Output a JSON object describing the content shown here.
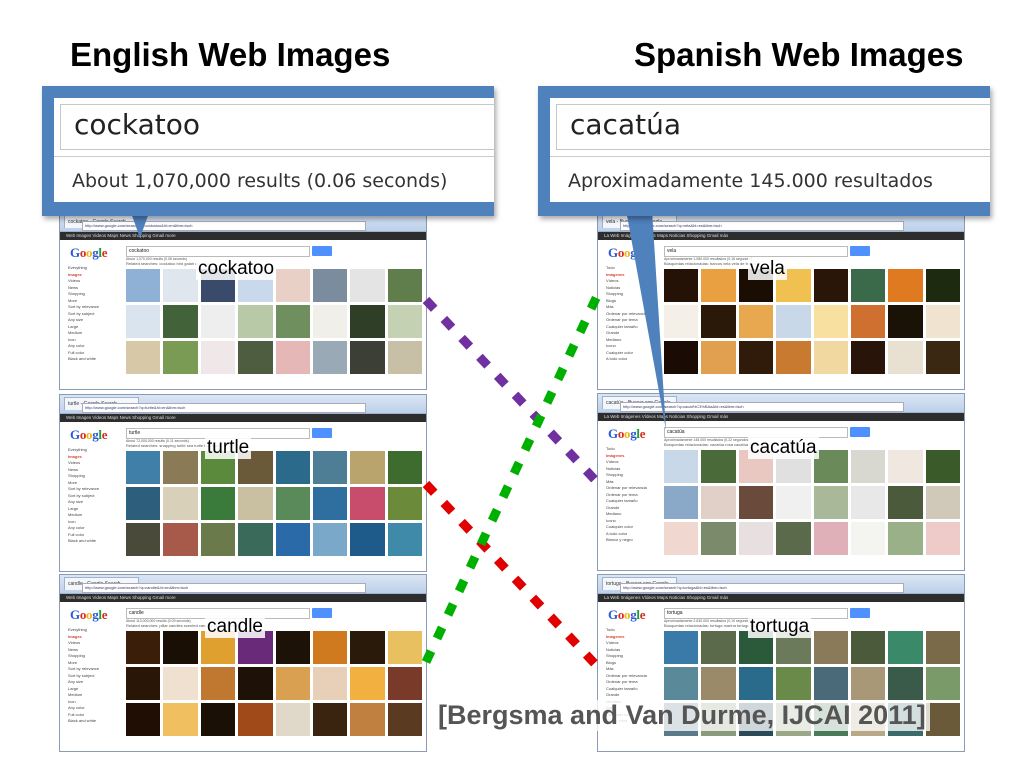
{
  "headings": {
    "left": "English Web Images",
    "right": "Spanish Web Images"
  },
  "callouts": {
    "left": {
      "query": "cockatoo",
      "count": "About 1,070,000 results (0.06 seconds)"
    },
    "right": {
      "query": "cacatúa",
      "count": "Aproximadamente 145.000 resultados"
    }
  },
  "logo_letters": [
    "G",
    "o",
    "o",
    "g",
    "l",
    "e"
  ],
  "panels": {
    "en_cockatoo": {
      "tab": "cockatoo - Google Search",
      "address": "http://www.google.com/search?q=cockatoo&hl=en&tbm=isch",
      "gbar": "Web  Images  Videos  Maps  News  Shopping  Gmail  more",
      "query": "cockatoo",
      "results": "About 1,070,000 results (0.06 seconds)",
      "related": "Related searches: cockatoo bird  galah cockatoo",
      "side": [
        "Everything",
        "Images",
        "Videos",
        "News",
        "Shopping",
        "More",
        "Sort by relevance",
        "Sort by subject",
        "Any size",
        "Large",
        "Medium",
        "Icon",
        "Any color",
        "Full color",
        "Black and white"
      ],
      "caption": "cockatoo",
      "thumb_colors": [
        "#8fb1d6",
        "#dfe6ee",
        "#3a4a6a",
        "#c9d8ea",
        "#e8d0c6",
        "#7b8c9e",
        "#e4e4e4",
        "#5f7e4c",
        "#d9e4ef",
        "#42623a",
        "#eeeeee",
        "#b8c9a8",
        "#6f8f5e",
        "#f1efe9",
        "#2f3e26",
        "#c4d1b3",
        "#d7c9a8",
        "#7a9b53",
        "#f0e8e8",
        "#4e5d3f",
        "#e6b7b7",
        "#9aa9b6",
        "#3b3f35",
        "#c8c0a6"
      ]
    },
    "en_turtle": {
      "tab": "turtle - Google Search",
      "address": "http://www.google.com/search?q=turtle&hl=en&tbm=isch",
      "gbar": "Web  Images  Videos  Maps  News  Shopping  Gmail  more",
      "query": "turtle",
      "results": "About 72,000,000 results (0.11 seconds)",
      "related": "Related searches: snapping turtle  sea turtle  box turtle",
      "side": [
        "Everything",
        "Images",
        "Videos",
        "News",
        "Shopping",
        "More",
        "Sort by relevance",
        "Sort by subject",
        "Any size",
        "Large",
        "Medium",
        "Icon",
        "Any color",
        "Full color",
        "Black and white"
      ],
      "caption": "turtle",
      "thumb_colors": [
        "#3f7fa8",
        "#8a7a56",
        "#5b8a3c",
        "#6a5a3a",
        "#2c6a8c",
        "#4e7e96",
        "#b8a46c",
        "#3e6b2e",
        "#2d5f7c",
        "#d8d0b8",
        "#3a7a3a",
        "#c8c0a0",
        "#5a8a5a",
        "#2f6f9f",
        "#c84c6c",
        "#6b8b3b",
        "#4a4a3a",
        "#a85a4a",
        "#6a7a4a",
        "#3a6a5a",
        "#2a6aa8",
        "#7aa8c8",
        "#1e5a8a",
        "#3e8aa8"
      ]
    },
    "en_candle": {
      "tab": "candle - Google Search",
      "address": "http://www.google.com/search?q=candle&hl=en&tbm=isch",
      "gbar": "Web  Images  Videos  Maps  News  Shopping  Gmail  more",
      "query": "candle",
      "results": "About 110,000,000 results (0.09 seconds)",
      "related": "Related searches: pillar candles  scented candles  candle holders",
      "side": [
        "Everything",
        "Images",
        "Videos",
        "News",
        "Shopping",
        "More",
        "Sort by relevance",
        "Sort by subject",
        "Any size",
        "Large",
        "Medium",
        "Icon",
        "Any color",
        "Full color",
        "Black and white"
      ],
      "caption": "candle",
      "thumb_colors": [
        "#3a1e0a",
        "#1a0f05",
        "#e0a030",
        "#6a2a7a",
        "#1c1208",
        "#d07a20",
        "#2a1a0a",
        "#e8c060",
        "#2a1606",
        "#f0e0d0",
        "#c07830",
        "#1e1208",
        "#d8a050",
        "#e8d0b8",
        "#f2b040",
        "#7a3a2a",
        "#200e04",
        "#f0c060",
        "#1a1006",
        "#a04a1a",
        "#e0d8c8",
        "#3a2410",
        "#c08040",
        "#5a3a20"
      ]
    },
    "es_vela": {
      "tab": "vela - Buscar con Google",
      "address": "http://www.google.com/search?q=vela&hl=es&tbm=isch",
      "gbar": "La Web  Imágenes  Vídeos  Maps  Noticias  Shopping  Gmail  más",
      "query": "vela",
      "results": "Aproximadamente 1.080.000 resultados (0,15 segundos)",
      "related": "Búsquedas relacionadas: barcos vela  vela de barco",
      "side": [
        "Todo",
        "Imágenes",
        "Vídeos",
        "Noticias",
        "Shopping",
        "Blogs",
        "Más",
        "Ordenar por relevancia",
        "Ordenar por tema",
        "Cualquier tamaño",
        "Grande",
        "Mediano",
        "Icono",
        "Cualquier color",
        "A todo color"
      ],
      "caption": "vela",
      "thumb_colors": [
        "#241206",
        "#e8a040",
        "#1a0e04",
        "#f0c050",
        "#2a1608",
        "#3a6a4a",
        "#e07a20",
        "#1e2a10",
        "#f4f0e8",
        "#2a1808",
        "#e8a850",
        "#c8d8e8",
        "#f8e0a0",
        "#d07030",
        "#1a1206",
        "#f0e4d0",
        "#1a0c04",
        "#e0a050",
        "#301a0a",
        "#c87a30",
        "#f0d8a0",
        "#281408",
        "#e8e0d0",
        "#3a2812"
      ]
    },
    "es_cacatua": {
      "tab": "cacatúa - Buscar con Google",
      "address": "http://www.google.com/search?q=cacat%C3%BAa&hl=es&tbm=isch",
      "gbar": "La Web  Imágenes  Vídeos  Maps  Noticias  Shopping  Gmail  más",
      "query": "cacatúa",
      "results": "Aproximadamente 145.000 resultados (0,22 segundos)",
      "related": "Búsquedas relacionadas: cacatúa rosa  cacatúa blanca",
      "side": [
        "Todo",
        "Imágenes",
        "Vídeos",
        "Noticias",
        "Shopping",
        "Más",
        "Ordenar por relevancia",
        "Ordenar por tema",
        "Cualquier tamaño",
        "Grande",
        "Mediano",
        "Icono",
        "Cualquier color",
        "A todo color",
        "Blanco y negro"
      ],
      "caption": "cacatúa",
      "thumb_colors": [
        "#c8d8e8",
        "#4a6a3a",
        "#e8c8c0",
        "#e0e0e0",
        "#6a8a5a",
        "#d8d8d0",
        "#f0e8e0",
        "#3a5a2a",
        "#8aa8c8",
        "#e0d0c8",
        "#6a4a3a",
        "#f0f0f0",
        "#a8b898",
        "#e8e8e8",
        "#4a5a3a",
        "#d0c8b8",
        "#f0d8d0",
        "#7a8a6a",
        "#e8e0e0",
        "#5a6a4a",
        "#e0b0b8",
        "#f4f4f0",
        "#9ab088",
        "#eecac8"
      ]
    },
    "es_tortuga": {
      "tab": "tortuga - Buscar con Google",
      "address": "http://www.google.com/search?q=tortuga&hl=es&tbm=isch",
      "gbar": "La Web  Imágenes  Vídeos  Maps  Noticias  Shopping  Gmail  más",
      "query": "tortuga",
      "results": "Aproximadamente 2.630.000 resultados (0,10 segundos)",
      "related": "Búsquedas relacionadas: tortuga marina  tortuga gigante",
      "side": [
        "Todo",
        "Imágenes",
        "Vídeos",
        "Noticias",
        "Shopping",
        "Blogs",
        "Más",
        "Ordenar por relevancia",
        "Ordenar por tema",
        "Cualquier tamaño",
        "Grande",
        "Mediano",
        "Icono",
        "Cualquier color",
        "A todo color"
      ],
      "caption": "tortuga",
      "thumb_colors": [
        "#3a7aa8",
        "#5a6a4a",
        "#2a5a3a",
        "#6a7a5a",
        "#8a7a5a",
        "#4a5a3a",
        "#3a8a6a",
        "#7a6a4a",
        "#5a8a9a",
        "#9a8a6a",
        "#2a6a8a",
        "#6a8a4a",
        "#4a6a7a",
        "#a89878",
        "#3a5a4a",
        "#7a9a6a",
        "#5a7a8a",
        "#8a9a7a",
        "#2a4a5a",
        "#9aa888",
        "#4a7a5a",
        "#b8a888",
        "#3a6a6a",
        "#6a5a3a"
      ]
    }
  },
  "citation": "[Bergsma and Van Durme, IJCAI 2011]",
  "link_colors": {
    "cockatoo": "#7030a0",
    "turtle": "#e00000",
    "candle": "#00b000"
  },
  "callout_color": "#4f81bd"
}
